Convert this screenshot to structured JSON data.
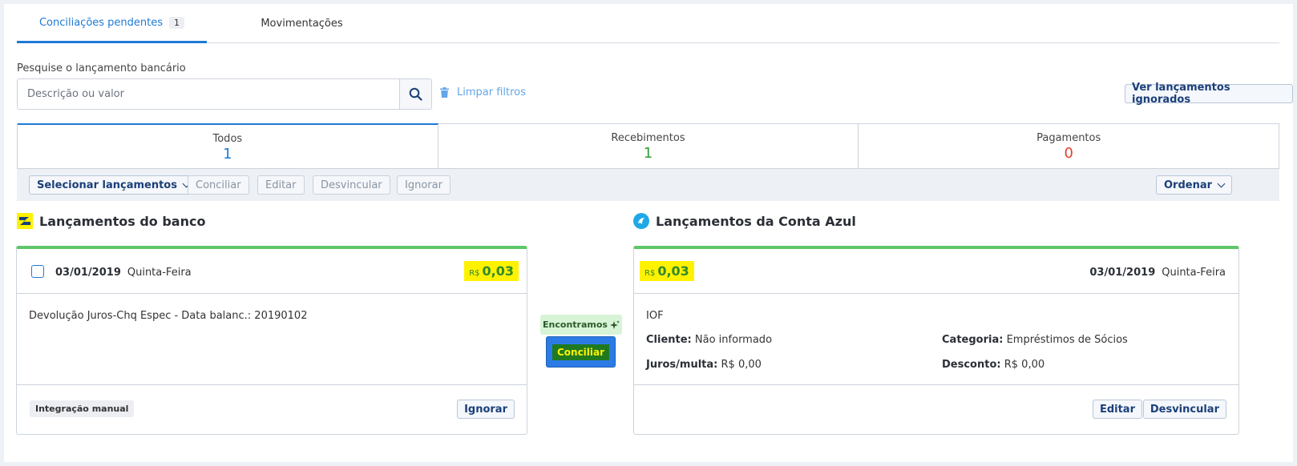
{
  "tabs": [
    {
      "label": "Conciliações pendentes",
      "count": "1"
    },
    {
      "label": "Movimentações"
    }
  ],
  "search": {
    "label": "Pesquise o lançamento bancário",
    "placeholder": "Descrição ou valor",
    "clear_label": "Limpar filtros",
    "ignored_label": "Ver lançamentos ignorados"
  },
  "summary": [
    {
      "label": "Todos",
      "value": "1",
      "color": "#1f7ad6"
    },
    {
      "label": "Recebimentos",
      "value": "1",
      "color": "#2f9a3a"
    },
    {
      "label": "Pagamentos",
      "value": "0",
      "color": "#e5402f"
    }
  ],
  "actions": {
    "select_label": "Selecionar lançamentos",
    "conciliar": "Conciliar",
    "editar": "Editar",
    "desvincular": "Desvincular",
    "ignorar": "Ignorar",
    "ordenar": "Ordenar"
  },
  "bank": {
    "title": "Lançamentos do banco",
    "date": "03/01/2019",
    "weekday": "Quinta-Feira",
    "currency": "R$",
    "amount": "0,03",
    "description": "Devolução Juros-Chq Espec - Data balanc.: 20190102",
    "tag": "Integração manual",
    "ignore_label": "Ignorar"
  },
  "match": {
    "found_label": "Encontramos",
    "conciliar_label": "Conciliar"
  },
  "contaazul": {
    "title": "Lançamentos da Conta Azul",
    "currency": "R$",
    "amount": "0,03",
    "date": "03/01/2019",
    "weekday": "Quinta-Feira",
    "description": "IOF",
    "cliente_label": "Cliente:",
    "cliente_value": "Não informado",
    "categoria_label": "Categoria:",
    "categoria_value": "Empréstimos de Sócios",
    "juros_label": "Juros/multa:",
    "juros_value": "R$ 0,00",
    "desconto_label": "Desconto:",
    "desconto_value": "R$ 0,00",
    "edit_label": "Editar",
    "unlink_label": "Desvincular"
  },
  "colors": {
    "accent": "#1f7ad6",
    "success_bar": "#5ec769",
    "highlight": "#fff200"
  }
}
